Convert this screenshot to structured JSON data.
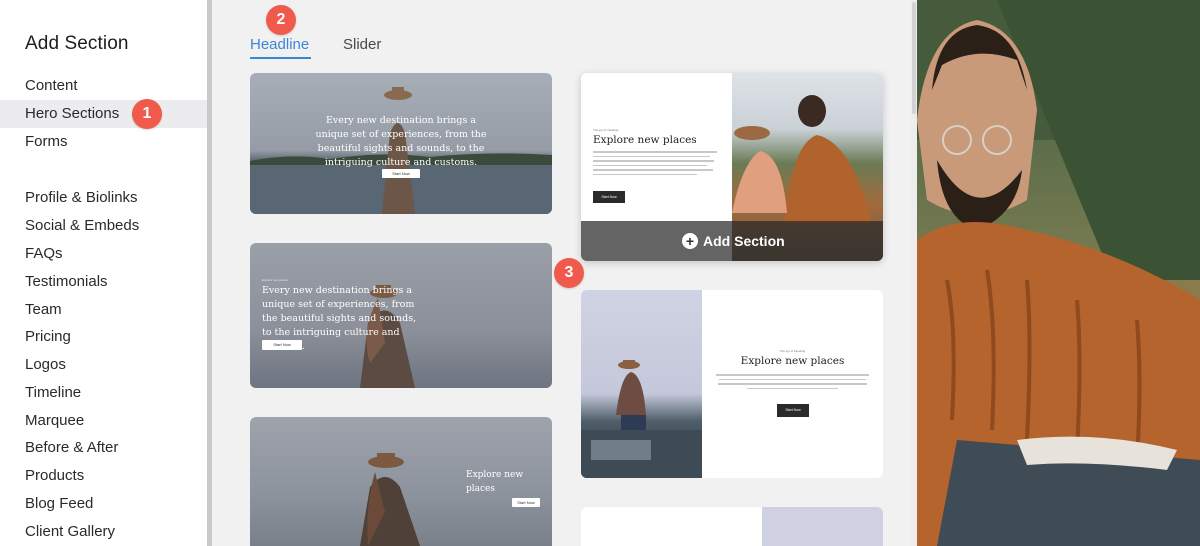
{
  "sidebar": {
    "title": "Add Section",
    "items": [
      {
        "label": "Content"
      },
      {
        "label": "Hero Sections"
      },
      {
        "label": "Forms"
      },
      {
        "label": "Profile & Biolinks"
      },
      {
        "label": "Social & Embeds"
      },
      {
        "label": "FAQs"
      },
      {
        "label": "Testimonials"
      },
      {
        "label": "Team"
      },
      {
        "label": "Pricing"
      },
      {
        "label": "Logos"
      },
      {
        "label": "Timeline"
      },
      {
        "label": "Marquee"
      },
      {
        "label": "Before & After"
      },
      {
        "label": "Products"
      },
      {
        "label": "Blog Feed"
      },
      {
        "label": "Client Gallery"
      }
    ],
    "active_item": "Hero Sections"
  },
  "tabs": [
    {
      "label": "Headline",
      "active": true
    },
    {
      "label": "Slider",
      "active": false
    }
  ],
  "badges": [
    "1",
    "2",
    "3"
  ],
  "cards": {
    "card1": {
      "text": "Every new destination brings a unique set of experiences, from the beautiful sights and sounds, to the intriguing culture and customs.",
      "cta": "Start Now"
    },
    "card2": {
      "eyebrow": "Explore new places",
      "text": "Every new destination brings a unique set of experiences, from the beautiful sights and sounds, to the intriguing culture and customs.",
      "cta": "Start Now"
    },
    "card3": {
      "title": "Explore new places",
      "cta": "Start Now"
    },
    "card4": {
      "eyebrow": "The joy of traveling",
      "title": "Explore new places",
      "cta": "Start Now",
      "add_section": "Add Section"
    },
    "card5": {
      "eyebrow": "The joy of traveling",
      "title": "Explore new places",
      "cta": "Start Now"
    }
  },
  "colors": {
    "accent": "#3a86d6",
    "badge": "#ef5a4c",
    "sidebar_active": "#ececee"
  }
}
